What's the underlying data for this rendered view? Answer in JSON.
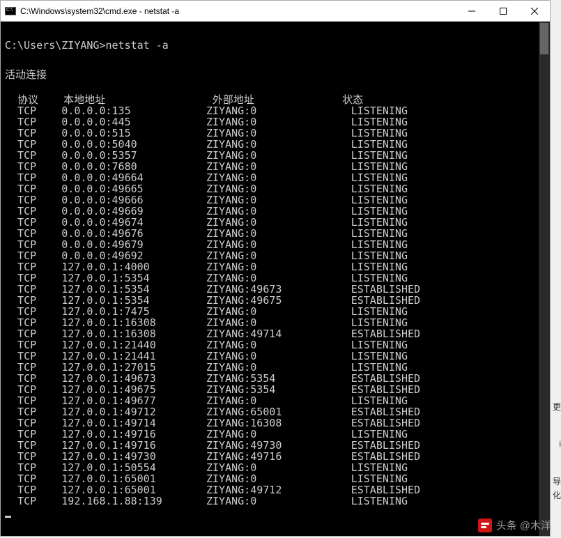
{
  "window": {
    "title": "C:\\Windows\\system32\\cmd.exe - netstat  -a"
  },
  "terminal": {
    "prompt": "C:\\Users\\ZIYANG>",
    "command": "netstat -a",
    "section_title": "活动连接",
    "headers": {
      "proto": "协议",
      "local": "本地地址",
      "foreign": "外部地址",
      "state": "状态"
    },
    "rows": [
      {
        "proto": "TCP",
        "local": "0.0.0.0:135",
        "foreign": "ZIYANG:0",
        "state": "LISTENING"
      },
      {
        "proto": "TCP",
        "local": "0.0.0.0:445",
        "foreign": "ZIYANG:0",
        "state": "LISTENING"
      },
      {
        "proto": "TCP",
        "local": "0.0.0.0:515",
        "foreign": "ZIYANG:0",
        "state": "LISTENING"
      },
      {
        "proto": "TCP",
        "local": "0.0.0.0:5040",
        "foreign": "ZIYANG:0",
        "state": "LISTENING"
      },
      {
        "proto": "TCP",
        "local": "0.0.0.0:5357",
        "foreign": "ZIYANG:0",
        "state": "LISTENING"
      },
      {
        "proto": "TCP",
        "local": "0.0.0.0:7680",
        "foreign": "ZIYANG:0",
        "state": "LISTENING"
      },
      {
        "proto": "TCP",
        "local": "0.0.0.0:49664",
        "foreign": "ZIYANG:0",
        "state": "LISTENING"
      },
      {
        "proto": "TCP",
        "local": "0.0.0.0:49665",
        "foreign": "ZIYANG:0",
        "state": "LISTENING"
      },
      {
        "proto": "TCP",
        "local": "0.0.0.0:49666",
        "foreign": "ZIYANG:0",
        "state": "LISTENING"
      },
      {
        "proto": "TCP",
        "local": "0.0.0.0:49669",
        "foreign": "ZIYANG:0",
        "state": "LISTENING"
      },
      {
        "proto": "TCP",
        "local": "0.0.0.0:49674",
        "foreign": "ZIYANG:0",
        "state": "LISTENING"
      },
      {
        "proto": "TCP",
        "local": "0.0.0.0:49676",
        "foreign": "ZIYANG:0",
        "state": "LISTENING"
      },
      {
        "proto": "TCP",
        "local": "0.0.0.0:49679",
        "foreign": "ZIYANG:0",
        "state": "LISTENING"
      },
      {
        "proto": "TCP",
        "local": "0.0.0.0:49692",
        "foreign": "ZIYANG:0",
        "state": "LISTENING"
      },
      {
        "proto": "TCP",
        "local": "127.0.0.1:4000",
        "foreign": "ZIYANG:0",
        "state": "LISTENING"
      },
      {
        "proto": "TCP",
        "local": "127.0.0.1:5354",
        "foreign": "ZIYANG:0",
        "state": "LISTENING"
      },
      {
        "proto": "TCP",
        "local": "127.0.0.1:5354",
        "foreign": "ZIYANG:49673",
        "state": "ESTABLISHED"
      },
      {
        "proto": "TCP",
        "local": "127.0.0.1:5354",
        "foreign": "ZIYANG:49675",
        "state": "ESTABLISHED"
      },
      {
        "proto": "TCP",
        "local": "127.0.0.1:7475",
        "foreign": "ZIYANG:0",
        "state": "LISTENING"
      },
      {
        "proto": "TCP",
        "local": "127.0.0.1:16308",
        "foreign": "ZIYANG:0",
        "state": "LISTENING"
      },
      {
        "proto": "TCP",
        "local": "127.0.0.1:16308",
        "foreign": "ZIYANG:49714",
        "state": "ESTABLISHED"
      },
      {
        "proto": "TCP",
        "local": "127.0.0.1:21440",
        "foreign": "ZIYANG:0",
        "state": "LISTENING"
      },
      {
        "proto": "TCP",
        "local": "127.0.0.1:21441",
        "foreign": "ZIYANG:0",
        "state": "LISTENING"
      },
      {
        "proto": "TCP",
        "local": "127.0.0.1:27015",
        "foreign": "ZIYANG:0",
        "state": "LISTENING"
      },
      {
        "proto": "TCP",
        "local": "127.0.0.1:49673",
        "foreign": "ZIYANG:5354",
        "state": "ESTABLISHED"
      },
      {
        "proto": "TCP",
        "local": "127.0.0.1:49675",
        "foreign": "ZIYANG:5354",
        "state": "ESTABLISHED"
      },
      {
        "proto": "TCP",
        "local": "127.0.0.1:49677",
        "foreign": "ZIYANG:0",
        "state": "LISTENING"
      },
      {
        "proto": "TCP",
        "local": "127.0.0.1:49712",
        "foreign": "ZIYANG:65001",
        "state": "ESTABLISHED"
      },
      {
        "proto": "TCP",
        "local": "127.0.0.1:49714",
        "foreign": "ZIYANG:16308",
        "state": "ESTABLISHED"
      },
      {
        "proto": "TCP",
        "local": "127.0.0.1:49716",
        "foreign": "ZIYANG:0",
        "state": "LISTENING"
      },
      {
        "proto": "TCP",
        "local": "127.0.0.1:49716",
        "foreign": "ZIYANG:49730",
        "state": "ESTABLISHED"
      },
      {
        "proto": "TCP",
        "local": "127.0.0.1:49730",
        "foreign": "ZIYANG:49716",
        "state": "ESTABLISHED"
      },
      {
        "proto": "TCP",
        "local": "127.0.0.1:50554",
        "foreign": "ZIYANG:0",
        "state": "LISTENING"
      },
      {
        "proto": "TCP",
        "local": "127.0.0.1:65001",
        "foreign": "ZIYANG:0",
        "state": "LISTENING"
      },
      {
        "proto": "TCP",
        "local": "127.0.0.1:65001",
        "foreign": "ZIYANG:49712",
        "state": "ESTABLISHED"
      },
      {
        "proto": "TCP",
        "local": "192.168.1.88:139",
        "foreign": "ZIYANG:0",
        "state": "LISTENING"
      }
    ]
  },
  "watermark": {
    "text": "头条 @木洋"
  },
  "edge": {
    "t1": "更",
    "t2": "i",
    "t3": "导",
    "t4": "化"
  }
}
